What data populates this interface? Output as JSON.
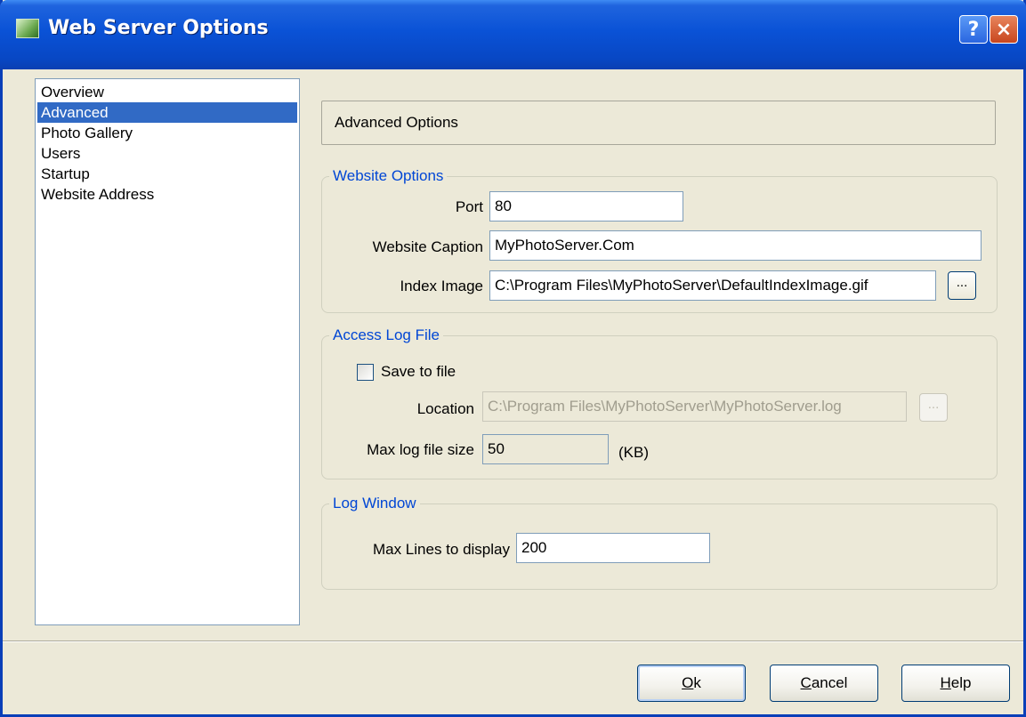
{
  "window": {
    "title": "Web Server Options"
  },
  "titlebar": {
    "help_label": "?",
    "close_label": "×"
  },
  "nav": {
    "items": [
      "Overview",
      "Advanced",
      "Photo Gallery",
      "Users",
      "Startup",
      "Website Address"
    ],
    "selected": "Advanced"
  },
  "header": {
    "title": "Advanced Options"
  },
  "website_options": {
    "legend": "Website Options",
    "port_label": "Port",
    "port_value": "80",
    "caption_label": "Website Caption",
    "caption_value": "MyPhotoServer.Com",
    "index_label": "Index Image",
    "index_value": "C:\\Program Files\\MyPhotoServer\\DefaultIndexImage.gif",
    "browse_label": "..."
  },
  "access_log": {
    "legend": "Access Log File",
    "save_label": "Save to file",
    "save_checked": false,
    "location_label": "Location",
    "location_value": "C:\\Program Files\\MyPhotoServer\\MyPhotoServer.log",
    "browse_label": "...",
    "max_size_label": "Max log file size",
    "max_size_value": "50",
    "unit_label": "(KB)"
  },
  "log_window": {
    "legend": "Log Window",
    "max_lines_label": "Max Lines to display",
    "max_lines_value": "200"
  },
  "buttons": {
    "ok_mnemonic": "O",
    "ok_rest": "k",
    "cancel_mnemonic": "C",
    "cancel_rest": "ancel",
    "help_mnemonic": "H",
    "help_rest": "elp"
  },
  "colors": {
    "title_bar": "#0a52d6",
    "dialog_bg": "#ece9d8",
    "selection": "#316ac5",
    "group_legend": "#0046d5"
  }
}
